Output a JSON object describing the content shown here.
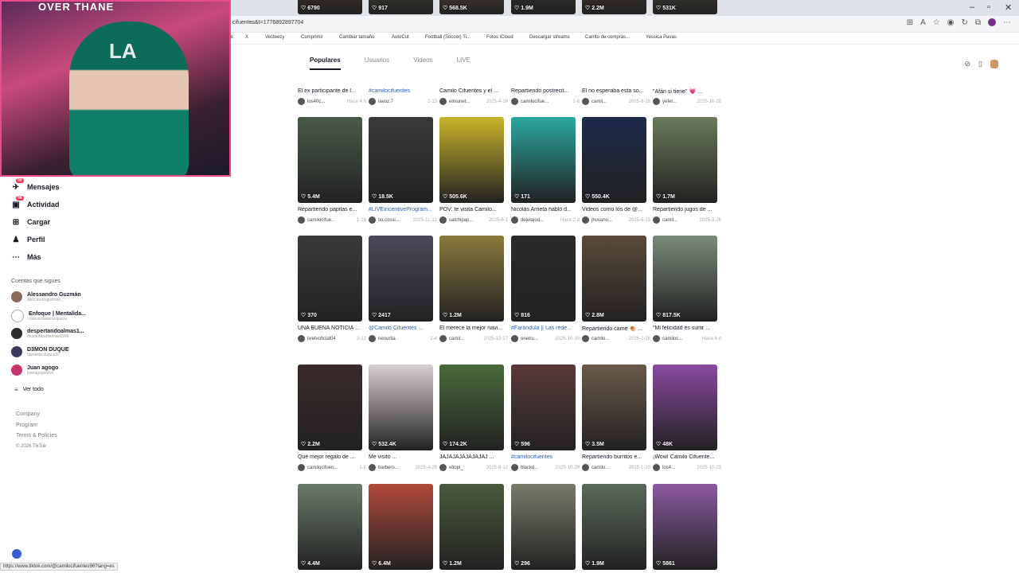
{
  "browser": {
    "url": "cifuentes&t=1776892897704",
    "bookmarks": [
      "k",
      "X",
      "Vecteezy",
      "Comprimir",
      "Cambiar tamaño",
      "AutoCut",
      "Football (Soccer) Ti...",
      "Fotos iCloud",
      "Descargar streams",
      "Carrito de compras...",
      "Yessica Pavas"
    ],
    "status_url": "https://www.tiktok.com/@camilocifuentes96?lang=es"
  },
  "webcam": {
    "overlay_text": "OVER THANE",
    "cap_logo": "LA"
  },
  "sidebar": {
    "nav": [
      {
        "label": "Mensajes",
        "icon": "paper-plane-icon",
        "badge": "99"
      },
      {
        "label": "Actividad",
        "icon": "inbox-icon",
        "badge": "99"
      },
      {
        "label": "Cargar",
        "icon": "plus-box-icon",
        "badge": ""
      },
      {
        "label": "Perfil",
        "icon": "profile-icon",
        "badge": ""
      },
      {
        "label": "Más",
        "icon": "more-icon",
        "badge": ""
      }
    ],
    "following_title": "Cuentas que sigues",
    "accounts": [
      {
        "name": "Alessandro Guzmán",
        "handle": "aleccandroguzman_"
      },
      {
        "name": "Enfoque | Mentalida...",
        "handle": "clubverdaderariqueza"
      },
      {
        "name": "despertandoalmas1...",
        "handle": "despertandoalmas1999"
      },
      {
        "name": "D3MON DUQUE",
        "handle": "danieldu duqu e37"
      },
      {
        "name": "Juan agogo",
        "handle": "juanagogoolive"
      }
    ],
    "see_all": "Ver todo",
    "footer": [
      "Company",
      "Program",
      "Terms & Policies",
      "© 2026 TikTok"
    ]
  },
  "tabs": [
    "Populares",
    "Usuarios",
    "Videos",
    "LIVE"
  ],
  "rows": [
    [
      {
        "views": "6790",
        "caption": "El ex participante de l...",
        "author": "los40c...",
        "date": "Hace 4 h",
        "hashtag": false,
        "bg": "#6b4a3a"
      },
      {
        "views": "917",
        "caption": "#camilocifuentes",
        "author": "lavoz.7",
        "date": "2-13",
        "hashtag": true,
        "bg": "#7a6a5a"
      },
      {
        "views": "568.5K",
        "caption": "Camilo Cifuentes y el ...",
        "author": "elmunet...",
        "date": "2025-4-16",
        "hashtag": false,
        "bg": "#8a7a6a"
      },
      {
        "views": "1.9M",
        "caption": "Repartiendo postrecit...",
        "author": "camilocifue...",
        "date": "1-8",
        "hashtag": false,
        "bg": "#5a4a3a"
      },
      {
        "views": "2.2M",
        "caption": "Él no esperaba esta so...",
        "author": "camil...",
        "date": "2025-8-28",
        "hashtag": false,
        "bg": "#6a5a4a"
      },
      {
        "views": "531K",
        "caption": "\"Afán si tiene\" 💗 ...",
        "author": "yefer...",
        "date": "2025-10-28",
        "hashtag": false,
        "bg": "#7a6a5a"
      }
    ],
    [
      {
        "views": "5.4M",
        "caption": "Repartiendo papitas e...",
        "author": "camilocifue...",
        "date": "1-19",
        "hashtag": false,
        "bg": "#4a5a4a"
      },
      {
        "views": "18.5K",
        "caption": "#LIVEIncentiveProgram...",
        "author": "tio.cossi...",
        "date": "2025-11-12",
        "hashtag": true,
        "bg": "#3a3a3a"
      },
      {
        "views": "505.6K",
        "caption": "POV: te visita Camilo...",
        "author": "salchipap...",
        "date": "2025-6-1",
        "hashtag": false,
        "bg": "#c9b42a"
      },
      {
        "views": "171",
        "caption": "Nicolás Arrieta habló d...",
        "author": "dejelajod...",
        "date": "Hace 2 d",
        "hashtag": false,
        "bg": "#2aa9a0"
      },
      {
        "views": "550.4K",
        "caption": "Videos como los de @...",
        "author": "jhovano...",
        "date": "2025-6-13",
        "hashtag": false,
        "bg": "#1d2a4a"
      },
      {
        "views": "1.7M",
        "caption": "Repartiendo jugos de ...",
        "author": "camil...",
        "date": "2025-3-26",
        "hashtag": false,
        "bg": "#6a7a5a"
      }
    ],
    [
      {
        "views": "370",
        "caption": "UNA BUENA NOTICIA ...",
        "author": "livetvoficial04",
        "date": "2-12",
        "hashtag": false,
        "bg": "#3a3a3a"
      },
      {
        "views": "2417",
        "caption": "@Camilo Cifuentes ...",
        "author": "nenurita",
        "date": "2-4",
        "hashtag": true,
        "bg": "#4a4a5a"
      },
      {
        "views": "1.2M",
        "caption": "Él merece la mejor navi...",
        "author": "camil...",
        "date": "2025-12-17",
        "hashtag": false,
        "bg": "#8a7a3a"
      },
      {
        "views": "816",
        "caption": "#Farandula || Las rede...",
        "author": "oneiru...",
        "date": "2025-10-30",
        "hashtag": true,
        "bg": "#2a2a2a"
      },
      {
        "views": "2.8M",
        "caption": "Repartiendo carne 🍖 ...",
        "author": "camilo...",
        "date": "2025-2-16",
        "hashtag": false,
        "bg": "#5a4a3a"
      },
      {
        "views": "817.5K",
        "caption": "\"Mi felicidad es surtir ...",
        "author": "camiloc...",
        "date": "Hace 6 d",
        "hashtag": false,
        "bg": "#7a8a7a"
      }
    ],
    [
      {
        "views": "2.2M",
        "caption": "Qué mejor regalo de ...",
        "author": "camilocifuen...",
        "date": "1-5",
        "hashtag": false,
        "bg": "#3a2a2a"
      },
      {
        "views": "532.4K",
        "caption": "Me visitó ...",
        "author": "barbero...",
        "date": "2025-4-26",
        "hashtag": false,
        "bg": "#d8d0d0"
      },
      {
        "views": "174.2K",
        "caption": "JAJAJAJAJAJAJAJ ...",
        "author": "eltopi_",
        "date": "2025-8-12",
        "hashtag": false,
        "bg": "#4a6a3a"
      },
      {
        "views": "596",
        "caption": "#camilocifuentes",
        "author": "blackd...",
        "date": "2025-10-29",
        "hashtag": true,
        "bg": "#5a3a3a"
      },
      {
        "views": "3.5M",
        "caption": "Repartiendo burritos e...",
        "author": "camilo...",
        "date": "2025-1-20",
        "hashtag": false,
        "bg": "#6a5a4a"
      },
      {
        "views": "48K",
        "caption": "¡Wow! Camilo Cifuente...",
        "author": "los4...",
        "date": "2025-10-23",
        "hashtag": false,
        "bg": "#8a4aa0"
      }
    ],
    [
      {
        "views": "4.4M",
        "caption": "",
        "author": "",
        "date": "",
        "hashtag": false,
        "bg": "#6a7a6a"
      },
      {
        "views": "6.4M",
        "caption": "",
        "author": "",
        "date": "",
        "hashtag": false,
        "bg": "#b04a3a"
      },
      {
        "views": "1.2M",
        "caption": "",
        "author": "",
        "date": "",
        "hashtag": false,
        "bg": "#4a5a3a"
      },
      {
        "views": "296",
        "caption": "",
        "author": "",
        "date": "",
        "hashtag": false,
        "bg": "#7a7a6a"
      },
      {
        "views": "1.9M",
        "caption": "",
        "author": "",
        "date": "",
        "hashtag": false,
        "bg": "#5a6a5a"
      },
      {
        "views": "5861",
        "caption": "",
        "author": "",
        "date": "",
        "hashtag": false,
        "bg": "#8a5aa0"
      }
    ]
  ]
}
